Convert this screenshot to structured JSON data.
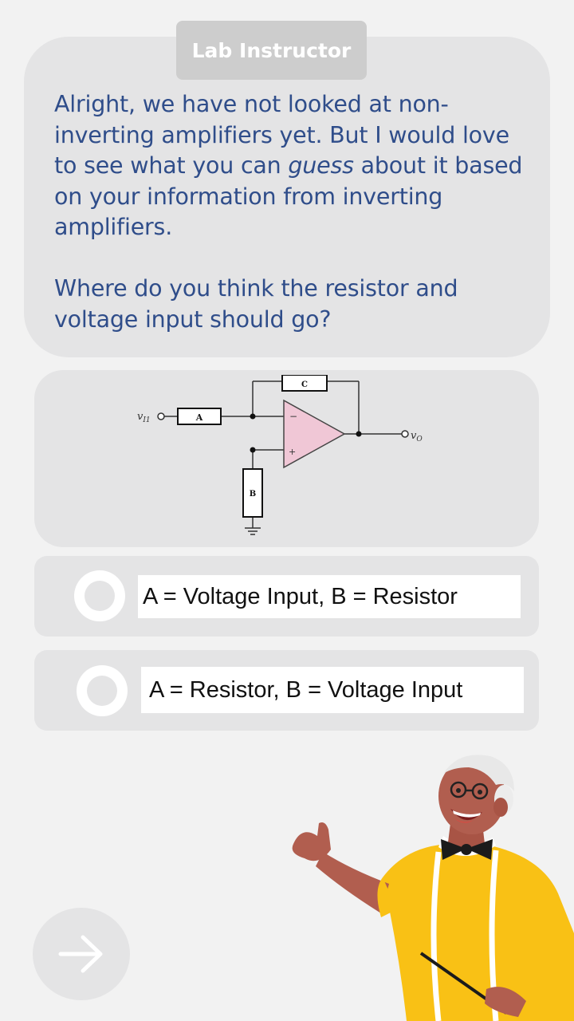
{
  "speaker": {
    "label": "Lab Instructor"
  },
  "message": {
    "para1_before": "Alright, we have not looked at non-inverting amplifiers yet. But I would love to see what you can ",
    "para1_emph": "guess",
    "para1_after": " about it based on your information from inverting amplifiers.",
    "para2": "Where do you think the resistor and voltage input should go?"
  },
  "diagram": {
    "label_a": "A",
    "label_b": "B",
    "label_c": "C",
    "minus": "−",
    "plus": "+",
    "input_label": "v",
    "input_sub": "I1",
    "output_label": "v",
    "output_sub": "O"
  },
  "options": [
    {
      "label": "A = Voltage Input, B = Resistor"
    },
    {
      "label": "A = Resistor, B = Voltage Input"
    }
  ],
  "colors": {
    "background": "#f2f2f2",
    "card": "#e4e4e5",
    "text_blue": "#2f4d8a",
    "tag": "#cdcdcd",
    "opamp_fill": "#f0c7d6",
    "shirt": "#f9c115",
    "skin": "#b15e4f"
  },
  "icons": {
    "next": "arrow-right-icon",
    "radio": "radio-icon"
  }
}
